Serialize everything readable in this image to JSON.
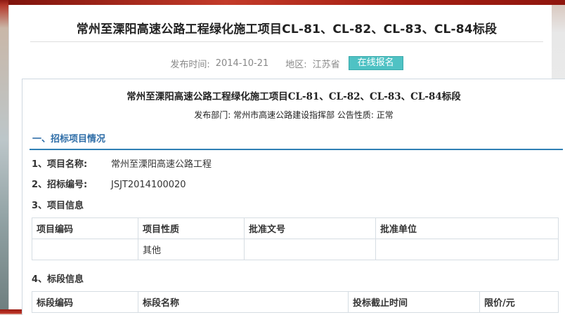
{
  "page": {
    "title": "常州至溧阳高速公路工程绿化施工项目CL-81、CL-82、CL-83、CL-84标段",
    "meta": {
      "publish_label": "发布时间:",
      "publish_date": "2014-10-21",
      "region_label": "地区:",
      "region": "江苏省",
      "enroll_button": "在线报名"
    }
  },
  "doc": {
    "title": "常州至溧阳高速公路工程绿化施工项目CL-81、CL-82、CL-83、CL-84标段",
    "subtitle": "发布部门: 常州市高速公路建设指挥部 公告性质:  正常",
    "section1": "一、招标项目情况",
    "project_name_label": "1、项目名称:",
    "project_name": "常州至溧阳高速公路工程",
    "bid_no_label": "2、招标编号:",
    "bid_no": "JSJT2014100020",
    "project_info_label": "3、项目信息",
    "project_table": {
      "headers": [
        "项目编码",
        "项目性质",
        "批准文号",
        "批准单位"
      ],
      "rows": [
        [
          "",
          "其他",
          "",
          ""
        ]
      ]
    },
    "section_info_label": "4、标段信息",
    "section_table": {
      "headers": [
        "标段编码",
        "标段名称",
        "投标截止时间",
        "限价/元"
      ]
    }
  },
  "colors": {
    "accent_blue": "#2f6ea8",
    "enroll_bg": "#4fc2c4",
    "top_band": "#c0392b"
  }
}
